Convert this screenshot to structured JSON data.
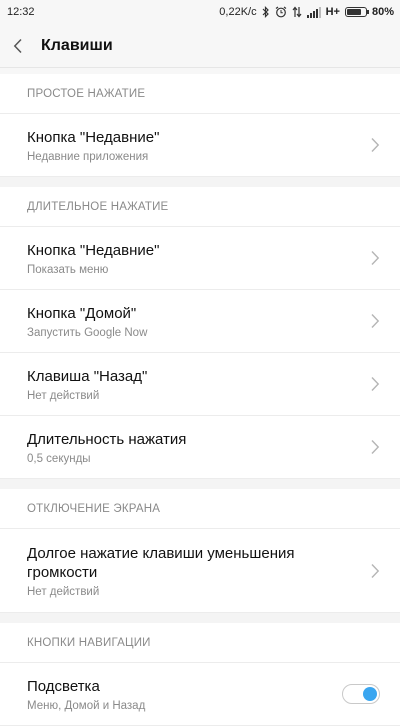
{
  "status_bar": {
    "time": "12:32",
    "speed": "0,22K/c",
    "network": "H+",
    "battery": "80%",
    "battery_level": 0.8,
    "icons": [
      "bluetooth-icon",
      "alarm-icon",
      "data-arrows-icon",
      "signal-icon",
      "battery-icon"
    ]
  },
  "header": {
    "title": "Клавиши",
    "back_icon": "chevron-left-icon"
  },
  "sections": {
    "short_press": {
      "header": "ПРОСТОЕ НАЖАТИЕ",
      "items": [
        {
          "title": "Кнопка \"Недавние\"",
          "subtitle": "Недавние приложения"
        }
      ]
    },
    "long_press": {
      "header": "ДЛИТЕЛЬНОЕ НАЖАТИЕ",
      "items": [
        {
          "title": "Кнопка \"Недавние\"",
          "subtitle": "Показать меню"
        },
        {
          "title": "Кнопка \"Домой\"",
          "subtitle": "Запустить Google Now"
        },
        {
          "title": "Клавиша \"Назад\"",
          "subtitle": "Нет действий"
        },
        {
          "title": "Длительность нажатия",
          "subtitle": "0,5 секунды"
        }
      ]
    },
    "screen_off": {
      "header": "ОТКЛЮЧЕНИЕ ЭКРАНА",
      "items": [
        {
          "title": "Долгое нажатие клавиши уменьшения громкости",
          "subtitle": "Нет действий"
        }
      ]
    },
    "nav_buttons": {
      "header": "КНОПКИ НАВИГАЦИИ",
      "items": [
        {
          "title": "Подсветка",
          "subtitle": "Меню, Домой и Назад",
          "toggle_on": true
        }
      ]
    }
  },
  "colors": {
    "accent": "#3aa6f0",
    "header_bg": "#f7f7f7",
    "section_text": "#8a8a8a"
  }
}
